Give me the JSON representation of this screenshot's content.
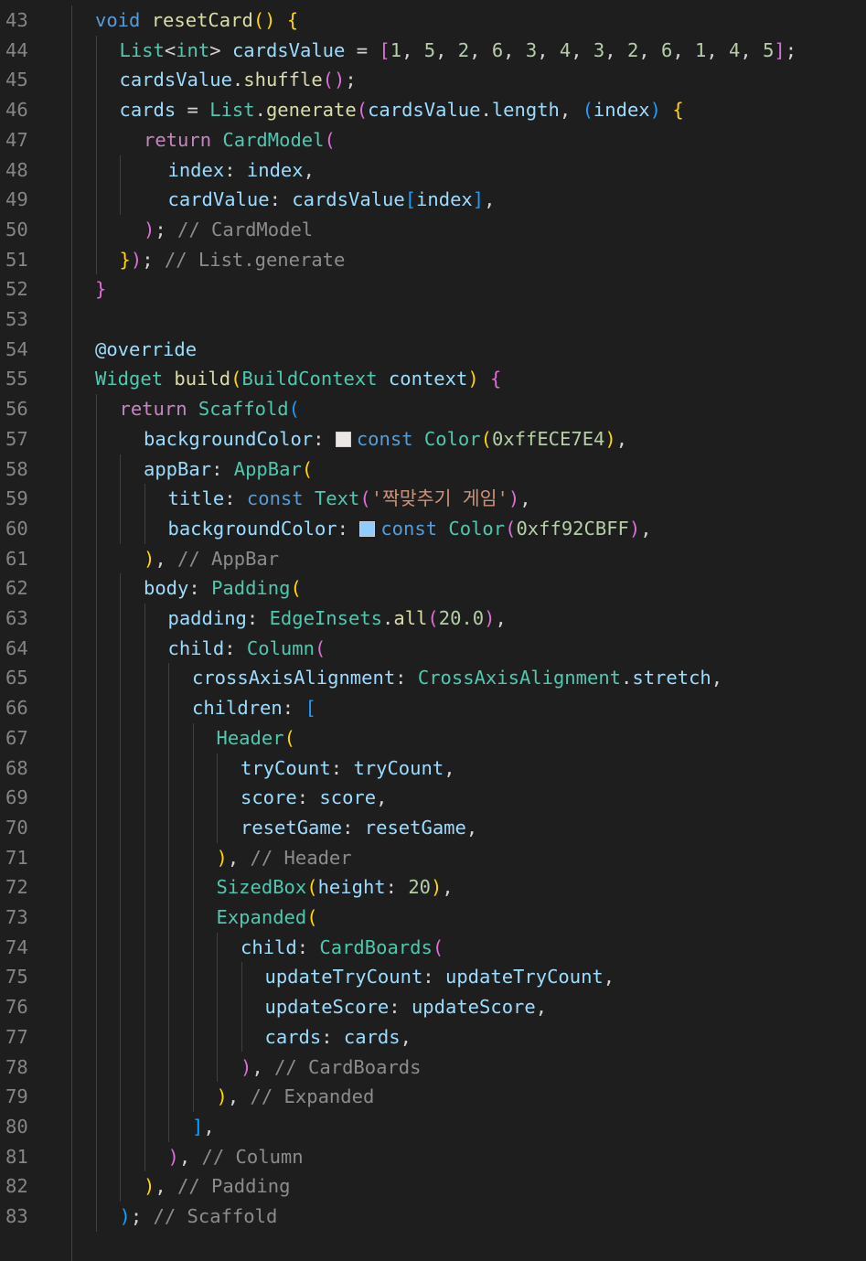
{
  "editor": {
    "lines": [
      {
        "n": "43",
        "indent": 1,
        "tokens": [
          {
            "t": "void",
            "c": "keyword"
          },
          {
            "t": " "
          },
          {
            "t": "resetCard",
            "c": "func"
          },
          {
            "t": "()",
            "c": "b1"
          },
          {
            "t": " "
          },
          {
            "t": "{",
            "c": "b1"
          }
        ]
      },
      {
        "n": "44",
        "indent": 2,
        "tokens": [
          {
            "t": "List",
            "c": "type"
          },
          {
            "t": "<",
            "c": "punct"
          },
          {
            "t": "int",
            "c": "type"
          },
          {
            "t": ">",
            "c": "punct"
          },
          {
            "t": " "
          },
          {
            "t": "cardsValue",
            "c": "var"
          },
          {
            "t": " = "
          },
          {
            "t": "[",
            "c": "b2"
          },
          {
            "t": "1",
            "c": "num"
          },
          {
            "t": ", "
          },
          {
            "t": "5",
            "c": "num"
          },
          {
            "t": ", "
          },
          {
            "t": "2",
            "c": "num"
          },
          {
            "t": ", "
          },
          {
            "t": "6",
            "c": "num"
          },
          {
            "t": ", "
          },
          {
            "t": "3",
            "c": "num"
          },
          {
            "t": ", "
          },
          {
            "t": "4",
            "c": "num"
          },
          {
            "t": ", "
          },
          {
            "t": "3",
            "c": "num"
          },
          {
            "t": ", "
          },
          {
            "t": "2",
            "c": "num"
          },
          {
            "t": ", "
          },
          {
            "t": "6",
            "c": "num"
          },
          {
            "t": ", "
          },
          {
            "t": "1",
            "c": "num"
          },
          {
            "t": ", "
          },
          {
            "t": "4",
            "c": "num"
          },
          {
            "t": ", "
          },
          {
            "t": "5",
            "c": "num"
          },
          {
            "t": "]",
            "c": "b2"
          },
          {
            "t": ";"
          }
        ]
      },
      {
        "n": "45",
        "indent": 2,
        "tokens": [
          {
            "t": "cardsValue",
            "c": "var"
          },
          {
            "t": "."
          },
          {
            "t": "shuffle",
            "c": "func"
          },
          {
            "t": "()",
            "c": "b2"
          },
          {
            "t": ";"
          }
        ]
      },
      {
        "n": "46",
        "indent": 2,
        "tokens": [
          {
            "t": "cards",
            "c": "var"
          },
          {
            "t": " = "
          },
          {
            "t": "List",
            "c": "type"
          },
          {
            "t": "."
          },
          {
            "t": "generate",
            "c": "func"
          },
          {
            "t": "(",
            "c": "b2"
          },
          {
            "t": "cardsValue",
            "c": "var"
          },
          {
            "t": "."
          },
          {
            "t": "length",
            "c": "var"
          },
          {
            "t": ", "
          },
          {
            "t": "(",
            "c": "b3"
          },
          {
            "t": "index",
            "c": "var"
          },
          {
            "t": ")",
            "c": "b3"
          },
          {
            "t": " "
          },
          {
            "t": "{",
            "c": "b1"
          }
        ]
      },
      {
        "n": "47",
        "indent": 3,
        "tokens": [
          {
            "t": "return",
            "c": "control"
          },
          {
            "t": " "
          },
          {
            "t": "CardModel",
            "c": "type"
          },
          {
            "t": "(",
            "c": "b2"
          }
        ]
      },
      {
        "n": "48",
        "indent": 4,
        "tokens": [
          {
            "t": "index",
            "c": "var"
          },
          {
            "t": ": "
          },
          {
            "t": "index",
            "c": "var"
          },
          {
            "t": ","
          }
        ]
      },
      {
        "n": "49",
        "indent": 4,
        "tokens": [
          {
            "t": "cardValue",
            "c": "var"
          },
          {
            "t": ": "
          },
          {
            "t": "cardsValue",
            "c": "var"
          },
          {
            "t": "[",
            "c": "b3"
          },
          {
            "t": "index",
            "c": "var"
          },
          {
            "t": "]",
            "c": "b3"
          },
          {
            "t": ","
          }
        ]
      },
      {
        "n": "50",
        "indent": 3,
        "tokens": [
          {
            "t": ")",
            "c": "b2"
          },
          {
            "t": "; "
          },
          {
            "t": "// CardModel",
            "c": "comment"
          }
        ]
      },
      {
        "n": "51",
        "indent": 2,
        "tokens": [
          {
            "t": "}",
            "c": "b1"
          },
          {
            "t": ")",
            "c": "b2"
          },
          {
            "t": "; "
          },
          {
            "t": "// List.generate",
            "c": "comment"
          }
        ]
      },
      {
        "n": "52",
        "indent": 1,
        "tokens": [
          {
            "t": "}",
            "c": "b2"
          }
        ]
      },
      {
        "n": "53",
        "indent": 1,
        "tokens": []
      },
      {
        "n": "54",
        "indent": 1,
        "tokens": [
          {
            "t": "@override",
            "c": "var"
          }
        ]
      },
      {
        "n": "55",
        "indent": 1,
        "tokens": [
          {
            "t": "Widget",
            "c": "type"
          },
          {
            "t": " "
          },
          {
            "t": "build",
            "c": "func"
          },
          {
            "t": "(",
            "c": "b1"
          },
          {
            "t": "BuildContext",
            "c": "type"
          },
          {
            "t": " "
          },
          {
            "t": "context",
            "c": "var"
          },
          {
            "t": ")",
            "c": "b1"
          },
          {
            "t": " "
          },
          {
            "t": "{",
            "c": "b2"
          }
        ]
      },
      {
        "n": "56",
        "indent": 2,
        "tokens": [
          {
            "t": "return",
            "c": "control"
          },
          {
            "t": " "
          },
          {
            "t": "Scaffold",
            "c": "type"
          },
          {
            "t": "(",
            "c": "b3"
          }
        ]
      },
      {
        "n": "57",
        "indent": 3,
        "tokens": [
          {
            "t": "backgroundColor",
            "c": "var"
          },
          {
            "t": ": "
          },
          {
            "swatch": "#ECE7E4"
          },
          {
            "t": "const",
            "c": "keyword"
          },
          {
            "t": " "
          },
          {
            "t": "Color",
            "c": "type"
          },
          {
            "t": "(",
            "c": "b1"
          },
          {
            "t": "0xffECE7E4",
            "c": "num"
          },
          {
            "t": ")",
            "c": "b1"
          },
          {
            "t": ","
          }
        ]
      },
      {
        "n": "58",
        "indent": 3,
        "tokens": [
          {
            "t": "appBar",
            "c": "var"
          },
          {
            "t": ": "
          },
          {
            "t": "AppBar",
            "c": "type"
          },
          {
            "t": "(",
            "c": "b1"
          }
        ]
      },
      {
        "n": "59",
        "indent": 4,
        "tokens": [
          {
            "t": "title",
            "c": "var"
          },
          {
            "t": ": "
          },
          {
            "t": "const",
            "c": "keyword"
          },
          {
            "t": " "
          },
          {
            "t": "Text",
            "c": "type"
          },
          {
            "t": "(",
            "c": "b2"
          },
          {
            "t": "'짝맞추기 게임'",
            "c": "str"
          },
          {
            "t": ")",
            "c": "b2"
          },
          {
            "t": ","
          }
        ]
      },
      {
        "n": "60",
        "indent": 4,
        "tokens": [
          {
            "t": "backgroundColor",
            "c": "var"
          },
          {
            "t": ": "
          },
          {
            "swatch": "#92CBFF"
          },
          {
            "t": "const",
            "c": "keyword"
          },
          {
            "t": " "
          },
          {
            "t": "Color",
            "c": "type"
          },
          {
            "t": "(",
            "c": "b2"
          },
          {
            "t": "0xff92CBFF",
            "c": "num"
          },
          {
            "t": ")",
            "c": "b2"
          },
          {
            "t": ","
          }
        ]
      },
      {
        "n": "61",
        "indent": 3,
        "tokens": [
          {
            "t": ")",
            "c": "b1"
          },
          {
            "t": ", "
          },
          {
            "t": "// AppBar",
            "c": "comment"
          }
        ]
      },
      {
        "n": "62",
        "indent": 3,
        "tokens": [
          {
            "t": "body",
            "c": "var"
          },
          {
            "t": ": "
          },
          {
            "t": "Padding",
            "c": "type"
          },
          {
            "t": "(",
            "c": "b1"
          }
        ]
      },
      {
        "n": "63",
        "indent": 4,
        "tokens": [
          {
            "t": "padding",
            "c": "var"
          },
          {
            "t": ": "
          },
          {
            "t": "EdgeInsets",
            "c": "type"
          },
          {
            "t": "."
          },
          {
            "t": "all",
            "c": "func"
          },
          {
            "t": "(",
            "c": "b2"
          },
          {
            "t": "20.0",
            "c": "num"
          },
          {
            "t": ")",
            "c": "b2"
          },
          {
            "t": ","
          }
        ]
      },
      {
        "n": "64",
        "indent": 4,
        "tokens": [
          {
            "t": "child",
            "c": "var"
          },
          {
            "t": ": "
          },
          {
            "t": "Column",
            "c": "type"
          },
          {
            "t": "(",
            "c": "b2"
          }
        ]
      },
      {
        "n": "65",
        "indent": 5,
        "tokens": [
          {
            "t": "crossAxisAlignment",
            "c": "var"
          },
          {
            "t": ": "
          },
          {
            "t": "CrossAxisAlignment",
            "c": "type"
          },
          {
            "t": "."
          },
          {
            "t": "stretch",
            "c": "var"
          },
          {
            "t": ","
          }
        ]
      },
      {
        "n": "66",
        "indent": 5,
        "tokens": [
          {
            "t": "children",
            "c": "var"
          },
          {
            "t": ": "
          },
          {
            "t": "[",
            "c": "b3"
          }
        ]
      },
      {
        "n": "67",
        "indent": 6,
        "tokens": [
          {
            "t": "Header",
            "c": "type"
          },
          {
            "t": "(",
            "c": "b1"
          }
        ]
      },
      {
        "n": "68",
        "indent": 7,
        "tokens": [
          {
            "t": "tryCount",
            "c": "var"
          },
          {
            "t": ": "
          },
          {
            "t": "tryCount",
            "c": "var"
          },
          {
            "t": ","
          }
        ]
      },
      {
        "n": "69",
        "indent": 7,
        "tokens": [
          {
            "t": "score",
            "c": "var"
          },
          {
            "t": ": "
          },
          {
            "t": "score",
            "c": "var"
          },
          {
            "t": ","
          }
        ]
      },
      {
        "n": "70",
        "indent": 7,
        "tokens": [
          {
            "t": "resetGame",
            "c": "var"
          },
          {
            "t": ": "
          },
          {
            "t": "resetGame",
            "c": "var"
          },
          {
            "t": ","
          }
        ]
      },
      {
        "n": "71",
        "indent": 6,
        "tokens": [
          {
            "t": ")",
            "c": "b1"
          },
          {
            "t": ", "
          },
          {
            "t": "// Header",
            "c": "comment"
          }
        ]
      },
      {
        "n": "72",
        "indent": 6,
        "tokens": [
          {
            "t": "SizedBox",
            "c": "type"
          },
          {
            "t": "(",
            "c": "b1"
          },
          {
            "t": "height",
            "c": "var"
          },
          {
            "t": ": "
          },
          {
            "t": "20",
            "c": "num"
          },
          {
            "t": ")",
            "c": "b1"
          },
          {
            "t": ","
          }
        ]
      },
      {
        "n": "73",
        "indent": 6,
        "tokens": [
          {
            "t": "Expanded",
            "c": "type"
          },
          {
            "t": "(",
            "c": "b1"
          }
        ]
      },
      {
        "n": "74",
        "indent": 7,
        "tokens": [
          {
            "t": "child",
            "c": "var"
          },
          {
            "t": ": "
          },
          {
            "t": "CardBoards",
            "c": "type"
          },
          {
            "t": "(",
            "c": "b2"
          }
        ]
      },
      {
        "n": "75",
        "indent": 8,
        "tokens": [
          {
            "t": "updateTryCount",
            "c": "var"
          },
          {
            "t": ": "
          },
          {
            "t": "updateTryCount",
            "c": "var"
          },
          {
            "t": ","
          }
        ]
      },
      {
        "n": "76",
        "indent": 8,
        "tokens": [
          {
            "t": "updateScore",
            "c": "var"
          },
          {
            "t": ": "
          },
          {
            "t": "updateScore",
            "c": "var"
          },
          {
            "t": ","
          }
        ]
      },
      {
        "n": "77",
        "indent": 8,
        "tokens": [
          {
            "t": "cards",
            "c": "var"
          },
          {
            "t": ": "
          },
          {
            "t": "cards",
            "c": "var"
          },
          {
            "t": ","
          }
        ]
      },
      {
        "n": "78",
        "indent": 7,
        "tokens": [
          {
            "t": ")",
            "c": "b2"
          },
          {
            "t": ", "
          },
          {
            "t": "// CardBoards",
            "c": "comment"
          }
        ]
      },
      {
        "n": "79",
        "indent": 6,
        "tokens": [
          {
            "t": ")",
            "c": "b1"
          },
          {
            "t": ", "
          },
          {
            "t": "// Expanded",
            "c": "comment"
          }
        ]
      },
      {
        "n": "80",
        "indent": 5,
        "tokens": [
          {
            "t": "]",
            "c": "b3"
          },
          {
            "t": ","
          }
        ]
      },
      {
        "n": "81",
        "indent": 4,
        "tokens": [
          {
            "t": ")",
            "c": "b2"
          },
          {
            "t": ", "
          },
          {
            "t": "// Column",
            "c": "comment"
          }
        ]
      },
      {
        "n": "82",
        "indent": 3,
        "tokens": [
          {
            "t": ")",
            "c": "b1"
          },
          {
            "t": ", "
          },
          {
            "t": "// Padding",
            "c": "comment"
          }
        ]
      },
      {
        "n": "83",
        "indent": 2,
        "tokens": [
          {
            "t": ")",
            "c": "b3"
          },
          {
            "t": "; "
          },
          {
            "t": "// Scaffold",
            "c": "comment"
          }
        ]
      }
    ],
    "guides": [
      {
        "level": 1,
        "from": 0,
        "to": 41
      },
      {
        "level": 2,
        "from": 1,
        "to": 8
      },
      {
        "level": 3,
        "from": 5,
        "to": 6
      },
      {
        "level": 2,
        "from": 13,
        "to": 40
      },
      {
        "level": 3,
        "from": 15,
        "to": 17
      },
      {
        "level": 3,
        "from": 19,
        "to": 39
      },
      {
        "level": 4,
        "from": 16,
        "to": 17
      },
      {
        "level": 4,
        "from": 20,
        "to": 38
      },
      {
        "level": 5,
        "from": 22,
        "to": 37
      },
      {
        "level": 6,
        "from": 24,
        "to": 36
      },
      {
        "level": 7,
        "from": 25,
        "to": 27
      },
      {
        "level": 7,
        "from": 31,
        "to": 35
      },
      {
        "level": 8,
        "from": 32,
        "to": 34
      }
    ]
  }
}
